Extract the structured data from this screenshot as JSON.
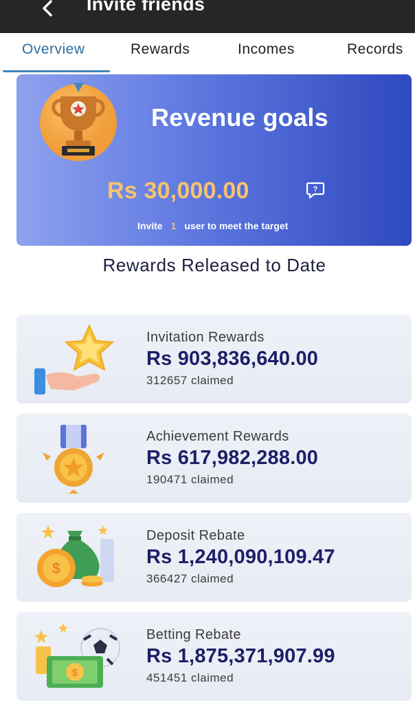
{
  "header": {
    "title": "Invite friends"
  },
  "tabs": [
    {
      "label": "Overview"
    },
    {
      "label": "Rewards"
    },
    {
      "label": "Incomes"
    },
    {
      "label": "Records"
    }
  ],
  "banner": {
    "title": "Revenue goals",
    "amount": "Rs 30,000.00",
    "invite_prefix": "Invite",
    "invite_count": "1",
    "invite_suffix": "user to meet the target"
  },
  "section_title": "Rewards Released to Date",
  "cards": [
    {
      "label": "Invitation Rewards",
      "value": "Rs 903,836,640.00",
      "claimed": "312657 claimed",
      "icon": "hand-star-icon"
    },
    {
      "label": "Achievement Rewards",
      "value": "Rs 617,982,288.00",
      "claimed": "190471 claimed",
      "icon": "medal-icon"
    },
    {
      "label": "Deposit Rebate",
      "value": "Rs 1,240,090,109.47",
      "claimed": "366427 claimed",
      "icon": "money-bag-icon"
    },
    {
      "label": "Betting Rebate",
      "value": "Rs 1,875,371,907.99",
      "claimed": "451451 claimed",
      "icon": "ball-cash-icon"
    }
  ],
  "colors": {
    "topbar": "#262626",
    "active_tab": "#2f6f9e",
    "banner_start": "#8ea2ee",
    "banner_end": "#2f49bf",
    "gold": "#f6c36e",
    "value_text": "#1d1f67"
  }
}
